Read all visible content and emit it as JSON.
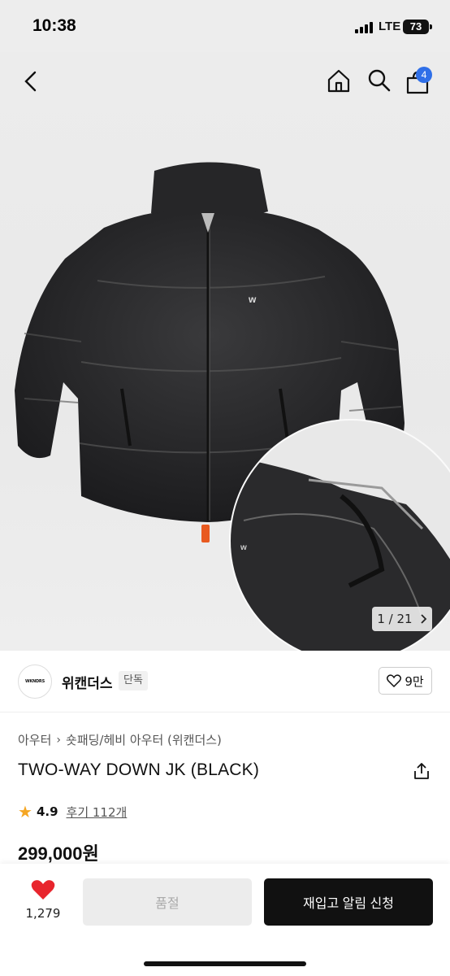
{
  "status_bar": {
    "time": "10:38",
    "network": "LTE",
    "battery": "73"
  },
  "nav": {
    "back_icon": "chevron-left-icon",
    "home_icon": "home-icon",
    "search_icon": "search-icon",
    "cart_icon": "shopping-bag-icon",
    "cart_count": "4"
  },
  "gallery": {
    "current": "1 / 21",
    "next_icon": "chevron-right-icon"
  },
  "brand": {
    "logo_text": "WKNDRS",
    "name": "위캔더스",
    "tag": "단독",
    "like_count": "9만"
  },
  "breadcrumb": [
    "아우터",
    "숏패딩/헤비 아우터 (위캔더스)"
  ],
  "product": {
    "title": "TWO-WAY DOWN JK (BLACK)",
    "rating": "4.9",
    "reviews": "후기 112개",
    "price": "299,000원"
  },
  "bottom": {
    "wish_count": "1,279",
    "soldout_label": "품절",
    "restock_label": "재입고 알림 신청"
  },
  "colors": {
    "accent_blue": "#2f6fe8",
    "heart_red": "#e8252d",
    "star": "#f5a623",
    "cta": "#111111"
  }
}
